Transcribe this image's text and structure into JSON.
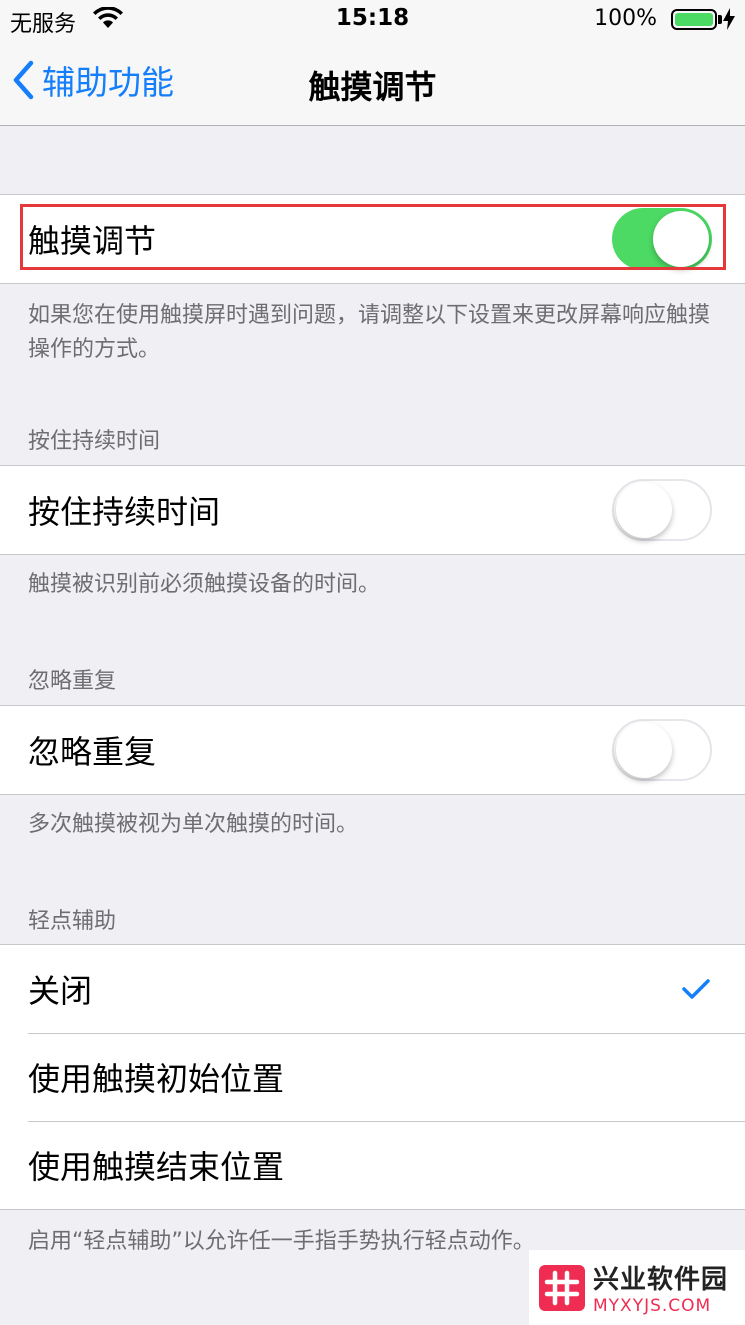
{
  "status_bar": {
    "carrier": "无服务",
    "time": "15:18",
    "battery_percent": "100%"
  },
  "nav": {
    "back_label": "辅助功能",
    "title": "触摸调节"
  },
  "touch_accommodations": {
    "label": "触摸调节",
    "enabled": true,
    "footer": "如果您在使用触摸屏时遇到问题，请调整以下设置来更改屏幕响应触摸操作的方式。"
  },
  "hold_duration": {
    "header": "按住持续时间",
    "label": "按住持续时间",
    "enabled": false,
    "footer": "触摸被识别前必须触摸设备的时间。"
  },
  "ignore_repeat": {
    "header": "忽略重复",
    "label": "忽略重复",
    "enabled": false,
    "footer": "多次触摸被视为单次触摸的时间。"
  },
  "tap_assistance": {
    "header": "轻点辅助",
    "options": [
      {
        "label": "关闭",
        "selected": true
      },
      {
        "label": "使用触摸初始位置",
        "selected": false
      },
      {
        "label": "使用触摸结束位置",
        "selected": false
      }
    ],
    "footer": "启用“轻点辅助”以允许任一手指手势执行轻点动作。"
  },
  "watermark": {
    "title": "兴业软件园",
    "url": "MYXYJS.COM"
  },
  "colors": {
    "accent": "#147efb",
    "toggle_on": "#4cd964",
    "highlight": "#e5383b"
  }
}
